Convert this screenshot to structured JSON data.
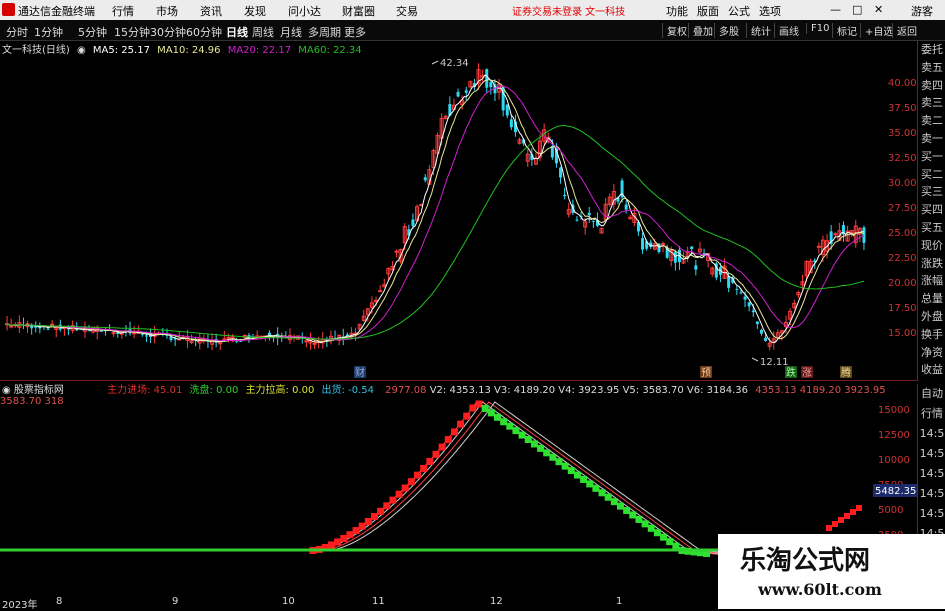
{
  "menubar": {
    "app_title": "通达信金融终端",
    "menus": [
      "行情",
      "市场",
      "资讯",
      "发现",
      "问小达",
      "财富圈",
      "交易"
    ],
    "notice": "证券交易未登录  文一科技",
    "right_items": [
      "功能",
      "版面",
      "公式",
      "选项"
    ],
    "guest": "游客"
  },
  "toolbar": {
    "periods": [
      "分时",
      "1分钟",
      "5分钟",
      "15分钟",
      "30分钟",
      "60分钟",
      "日线",
      "周线",
      "月线",
      "多周期",
      "更多"
    ],
    "active_period": "日线",
    "right_tools": [
      "复权",
      "叠加",
      "多股",
      "统计",
      "画线",
      "F10",
      "标记",
      "+自选",
      "返回"
    ]
  },
  "ma_line": {
    "stock": "文一科技(日线)",
    "ma5": "MA5: 25.17",
    "ma10": "MA10: 24.96",
    "ma20": "MA20: 22.17",
    "ma60": "MA60: 22.34",
    "colors": {
      "ma5": "#ffffff",
      "ma10": "#e8e89a",
      "ma20": "#d020d0",
      "ma60": "#20c020"
    }
  },
  "right_panel": {
    "items": [
      "委托",
      "卖五",
      "卖四",
      "卖三",
      "卖二",
      "卖一",
      "买一",
      "买二",
      "买三",
      "买四",
      "买五",
      "现价",
      "涨跌",
      "涨幅",
      "总量",
      "外盘",
      "换手",
      "净资",
      "收益"
    ],
    "items2": [
      "自动",
      "行情",
      "14:5",
      "14:5",
      "14:5",
      "14:5",
      "14:5",
      "14:5",
      "14:5"
    ]
  },
  "price_axis": [
    "40.00",
    "37.50",
    "35.00",
    "32.50",
    "30.00",
    "27.50",
    "25.00",
    "22.50",
    "20.00",
    "17.50",
    "15.00"
  ],
  "price_annotations": {
    "high": "42.34",
    "low": "12.11"
  },
  "event_tags": [
    "财",
    "预",
    "跌",
    "涨",
    "腾"
  ],
  "indicator": {
    "name": "股票指标网",
    "main_flow_label": "主力进场:",
    "main_flow": "45.01",
    "wash_label": "洗盘:",
    "wash": "0.00",
    "pull_label": "主力拉高:",
    "pull": "0.00",
    "exit_label": "出货:",
    "exit": "-0.54",
    "v1": "2977.08",
    "v2": "V2: 4353.13",
    "v3": "V3: 4189.20",
    "v4": "V4: 3923.95",
    "v5": "V5: 3583.70",
    "v6": "V6: 3184.36",
    "r1": "4353.13",
    "r2": "4189.20",
    "r3": "3923.95",
    "r4": "3583.70",
    "r5": "318",
    "axis": [
      "15000",
      "12500",
      "10000",
      "7500",
      "5000",
      "2500"
    ],
    "current_value": "5482.35"
  },
  "time_axis": [
    "2023年",
    "8",
    "9",
    "10",
    "11",
    "12",
    "1"
  ],
  "watermark": {
    "title": "乐淘公式网",
    "url": "www.60lt.com"
  }
}
